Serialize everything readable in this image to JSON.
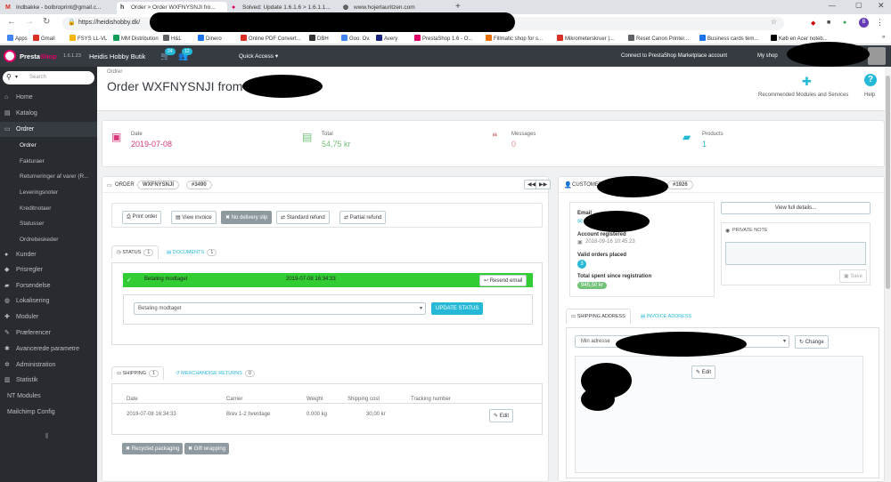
{
  "browser": {
    "tabs": [
      {
        "icon": "gmail-icon",
        "title": "Indbakke - bolbroprint@gmail.c..."
      },
      {
        "icon": "h-icon",
        "title": "Order > Order WXFNYSNJI fro..."
      },
      {
        "icon": "prestashop-icon",
        "title": "Solved: Update 1.6.1.6 > 1.6.1.1..."
      },
      {
        "icon": "globe-icon",
        "title": "www.hojerlauritzen.com"
      }
    ],
    "url": "https://heidishobby.dk/",
    "bookmarks": [
      "Apps",
      "Gmail",
      "FSYS LL-VL",
      "MM Distribution",
      "H&L",
      "Dinero",
      "Online PDF Convert...",
      "DBH",
      "Goo. Ov.",
      "Avery",
      "PrestaShop 1.6 - O...",
      "Fillmatic shop for s...",
      "Mikrometerskruer |...",
      "Reset Canon Printer...",
      "Business cards tem...",
      "Køb en Acer noteb..."
    ]
  },
  "header": {
    "brand_a": "Presta",
    "brand_b": "Shop",
    "version": "1.6.1.23",
    "shop": "Heidis Hobby Butik",
    "cart_badge": "24",
    "users_badge": "12",
    "quick_access": "Quick Access ▾",
    "connect": "Connect to PrestaShop Marketplace account",
    "my_shop": "My shop"
  },
  "sidebar": {
    "search_placeholder": "Search",
    "items": [
      {
        "label": "Home",
        "icon": "home-icon"
      },
      {
        "label": "Katalog",
        "icon": "catalog-icon"
      },
      {
        "label": "Ordrer",
        "icon": "credit-card-icon"
      },
      {
        "label": "Kunder",
        "icon": "user-icon"
      },
      {
        "label": "Prisregler",
        "icon": "tag-icon"
      },
      {
        "label": "Forsendelse",
        "icon": "truck-icon"
      },
      {
        "label": "Lokalisering",
        "icon": "globe-icon"
      },
      {
        "label": "Moduler",
        "icon": "puzzle-icon"
      },
      {
        "label": "Præferencer",
        "icon": "wrench-icon"
      },
      {
        "label": "Avancerede parametre",
        "icon": "gears-icon"
      },
      {
        "label": "Administration",
        "icon": "gear-icon"
      },
      {
        "label": "Statistik",
        "icon": "chart-icon"
      },
      {
        "label": "NT Modules",
        "icon": ""
      },
      {
        "label": "Mailchimp Config",
        "icon": ""
      }
    ],
    "subitems": [
      "Ordrer",
      "Fakturaer",
      "Returneringer af varer (R...",
      "Leveringsnoter",
      "Kreditnotaer",
      "Statusser",
      "Ordrebeskeder"
    ]
  },
  "page": {
    "breadcrumb": "Ordrer",
    "title": "Order WXFNYSNJI from",
    "toolbar": [
      {
        "label": "Recommended Modules and Services",
        "icon": "puzzle-icon"
      },
      {
        "label": "Help",
        "icon": "help-icon"
      }
    ]
  },
  "kpis": [
    {
      "label": "Date",
      "value": "2019-07-08",
      "icon": "calendar-icon",
      "color": "#d5397b"
    },
    {
      "label": "Total",
      "value": "54,75 kr",
      "icon": "money-icon",
      "color": "#72c279"
    },
    {
      "label": "Messages",
      "value": "0",
      "icon": "comments-icon",
      "color": "#e08f95"
    },
    {
      "label": "Products",
      "value": "1",
      "icon": "book-icon",
      "color": "#25b9d7"
    }
  ],
  "order": {
    "heading": "ORDER",
    "reference": "WXFNYSNJI",
    "id": "#3490",
    "actions": [
      "Print order",
      "View invoice",
      "No delivery slip",
      "Standard refund",
      "Partial refund"
    ],
    "tabs": [
      {
        "label": "STATUS",
        "count": "1"
      },
      {
        "label": "DOCUMENTS",
        "count": "1"
      }
    ],
    "status_row": {
      "status": "Betaling modtaget",
      "date": "2019-07-08 16:34:33",
      "resend": "Resend email"
    },
    "status_select": "Betaling modtaget",
    "update_button": "UPDATE STATUS"
  },
  "shipping": {
    "tabs": [
      {
        "label": "SHIPPING",
        "count": "1"
      },
      {
        "label": "MERCHANDISE RETURNS",
        "count": "0"
      }
    ],
    "columns": [
      "Date",
      "Carrier",
      "Weight",
      "Shipping cost",
      "Tracking number"
    ],
    "rows": [
      {
        "date": "2019-07-08 16:34:33",
        "carrier": "Brev 1-2 hverdage",
        "weight": "0.000 kg",
        "cost": "30,00 kr",
        "tracking": ""
      }
    ],
    "edit": "Edit",
    "tags": [
      "Recycled packaging",
      "Gift wrapping"
    ]
  },
  "customer": {
    "heading": "CUSTOMER",
    "id": "#1926",
    "email_label": "Email",
    "registered_label": "Account registered",
    "registered_value": "2018-09-16 10:45:23",
    "orders_label": "Valid orders placed",
    "orders_value": "3",
    "spent_label": "Total spent since registration",
    "spent_value": "945,50 kr",
    "view_details": "View full details...",
    "private_note": "PRIVATE NOTE",
    "save": "Save"
  },
  "address": {
    "tabs": [
      "SHIPPING ADDRESS",
      "INVOICE ADDRESS"
    ],
    "select": "Min adresse",
    "change": "Change",
    "edit": "Edit"
  }
}
